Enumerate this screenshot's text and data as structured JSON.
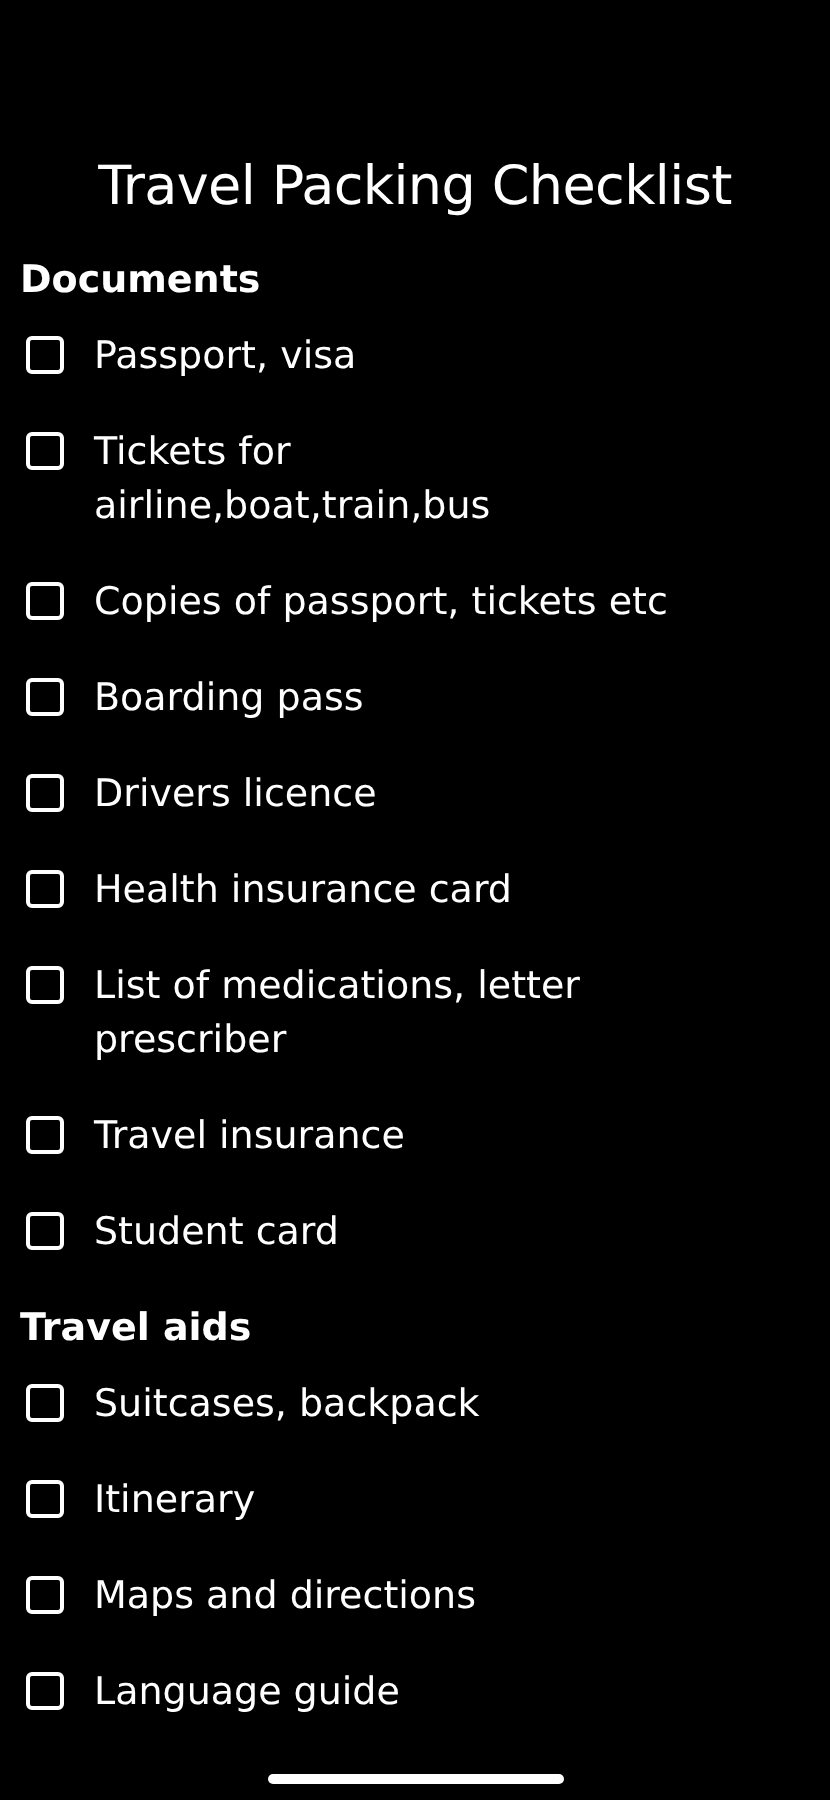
{
  "title": "Travel Packing Checklist",
  "sections": [
    {
      "heading": "Documents",
      "items": [
        {
          "label": "Passport, visa",
          "checked": false
        },
        {
          "label": "Tickets for airline,boat,train,bus",
          "checked": false
        },
        {
          "label": "Copies of passport, tickets etc",
          "checked": false
        },
        {
          "label": "Boarding pass",
          "checked": false
        },
        {
          "label": "Drivers licence",
          "checked": false
        },
        {
          "label": "Health insurance card",
          "checked": false
        },
        {
          "label": "List of medications, letter prescriber",
          "checked": false
        },
        {
          "label": "Travel insurance",
          "checked": false
        },
        {
          "label": "Student card",
          "checked": false
        }
      ]
    },
    {
      "heading": "Travel aids",
      "items": [
        {
          "label": "Suitcases, backpack",
          "checked": false
        },
        {
          "label": "Itinerary",
          "checked": false
        },
        {
          "label": "Maps and directions",
          "checked": false
        },
        {
          "label": "Language guide",
          "checked": false
        }
      ]
    }
  ]
}
